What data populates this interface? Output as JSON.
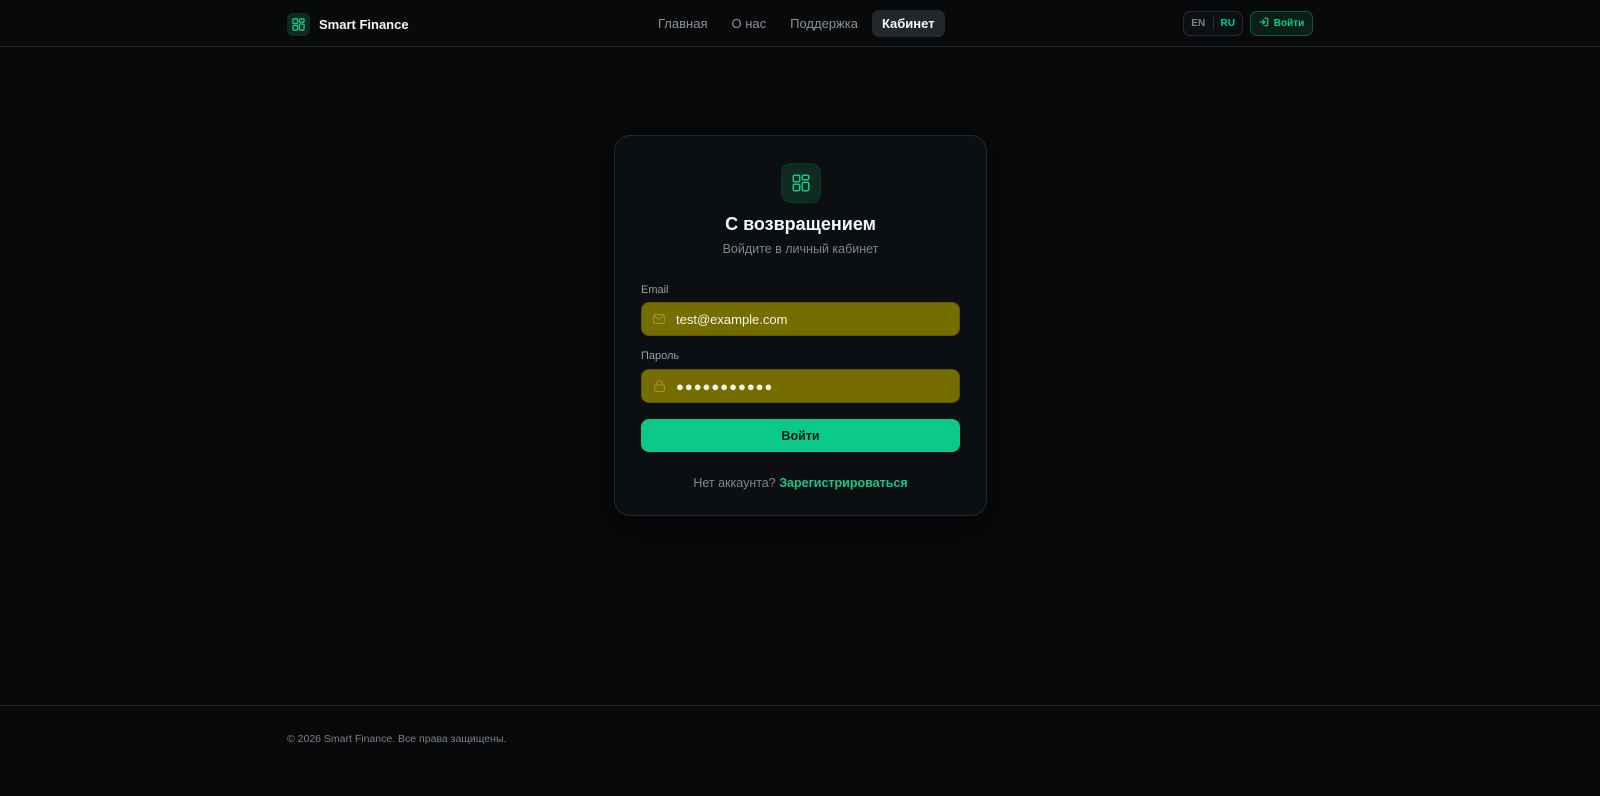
{
  "header": {
    "brand_name": "Smart Finance",
    "brand_icon": "dashboard-grid-icon",
    "nav": [
      {
        "label": "Главная",
        "active": false
      },
      {
        "label": "О нас",
        "active": false
      },
      {
        "label": "Поддержка",
        "active": false
      },
      {
        "label": "Кабинет",
        "active": true
      }
    ],
    "lang": {
      "en": "EN",
      "ru": "RU",
      "selected": "RU"
    },
    "login_button": {
      "label": "Войти",
      "icon": "login-arrow-icon"
    }
  },
  "card": {
    "logo_icon": "dashboard-grid-icon",
    "title": "С возвращением",
    "subtitle": "Войдите в личный кабинет",
    "email": {
      "label": "Email",
      "value": "test@example.com",
      "icon": "mail-icon"
    },
    "password": {
      "label": "Пароль",
      "value": "●●●●●●●●●●●",
      "icon": "lock-icon"
    },
    "submit_label": "Войти",
    "register_prompt": "Нет аккаунта?",
    "register_link": "Зарегистрироваться"
  },
  "footer": {
    "copyright": "© 2026 Smart Finance. Все права защищены."
  },
  "colors": {
    "accent": "#0ac98a",
    "background": "#06080a",
    "card": "#0c0f11",
    "autofill_field": "#756d00"
  }
}
